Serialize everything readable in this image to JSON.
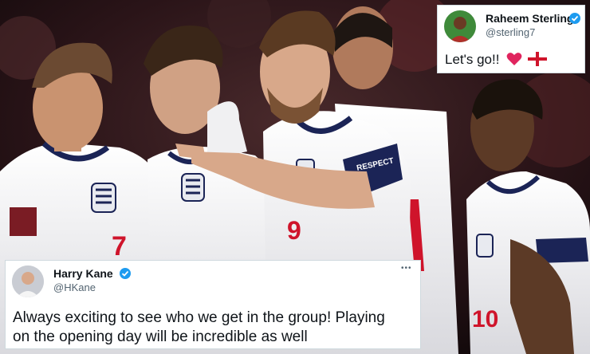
{
  "tweets": [
    {
      "author": "Raheem Sterling",
      "handle": "@sterling7",
      "text": "Let's go!!",
      "emoji": [
        "red-heart",
        "england-flag"
      ],
      "verified": true
    },
    {
      "author": "Harry Kane",
      "handle": "@HKane",
      "text_line1": "Always exciting to see who we get in the group! Playing",
      "text_line2": "on the opening day will be incredible as well",
      "verified": true,
      "menu_label": "•••"
    }
  ],
  "photo": {
    "subject": "England footballers celebrating in white kits",
    "kit_numbers": [
      "7",
      "9",
      "10"
    ],
    "armband_text": "RESPECT",
    "colors": {
      "kit": "#f4f4f4",
      "navy": "#1b2456",
      "red": "#cf142b",
      "background": "#2a1418"
    }
  }
}
